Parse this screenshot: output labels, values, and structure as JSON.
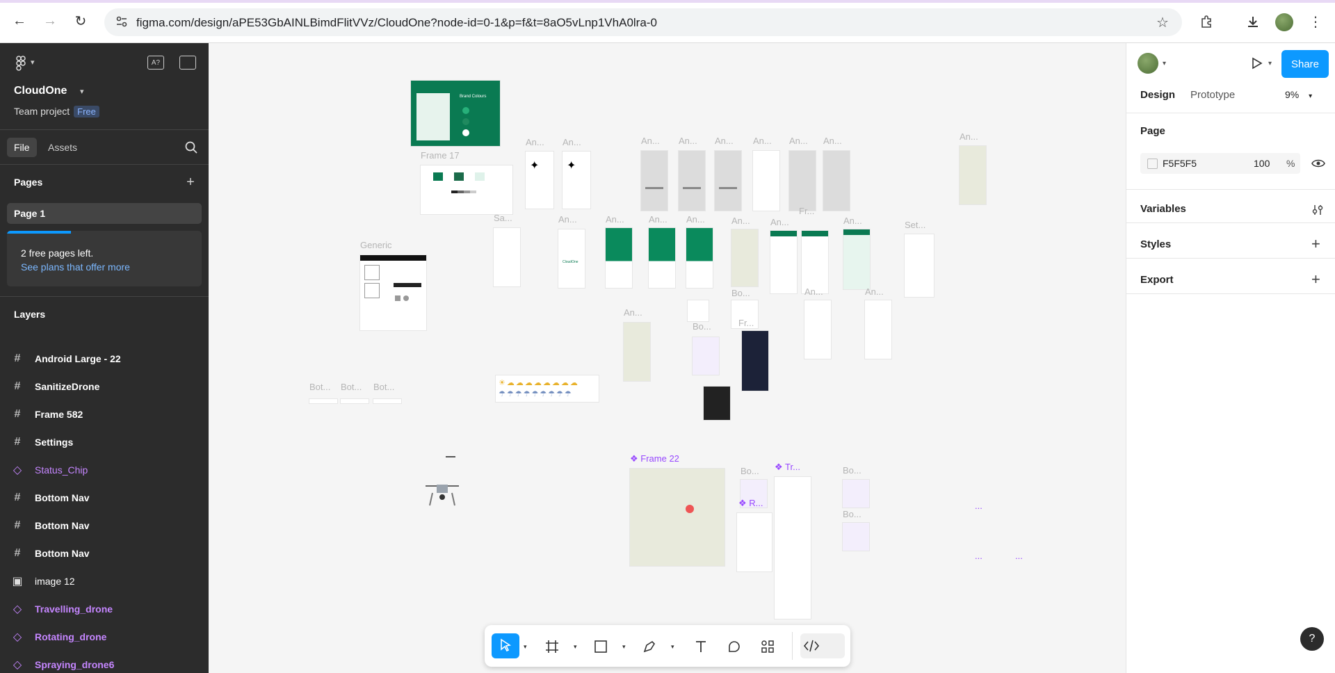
{
  "browser": {
    "url": "figma.com/design/aPE53GbAINLBimdFlitVVz/CloudOne?node-id=0-1&p=f&t=8aO5vLnp1VhA0lra-0"
  },
  "left_panel": {
    "project_name": "CloudOne",
    "team": "Team project",
    "plan_badge": "Free",
    "tabs": [
      "File",
      "Assets"
    ],
    "pages_title": "Pages",
    "pages": [
      "Page 1"
    ],
    "free_pages_text": "2 free pages left.",
    "free_pages_link": "See plans that offer more",
    "free_pages_progress": 0.33,
    "layers_title": "Layers",
    "layers": [
      {
        "label": "Android Large - 22",
        "type": "frame"
      },
      {
        "label": "SanitizeDrone",
        "type": "frame"
      },
      {
        "label": "Frame 582",
        "type": "frame"
      },
      {
        "label": "Settings",
        "type": "frame"
      },
      {
        "label": "Status_Chip",
        "type": "component"
      },
      {
        "label": "Bottom Nav",
        "type": "frame"
      },
      {
        "label": "Bottom Nav",
        "type": "frame"
      },
      {
        "label": "Bottom Nav",
        "type": "frame"
      },
      {
        "label": "image 12",
        "type": "image"
      },
      {
        "label": "Travelling_drone",
        "type": "component"
      },
      {
        "label": "Rotating_drone",
        "type": "component"
      },
      {
        "label": "Spraying_drone6",
        "type": "component"
      }
    ]
  },
  "right_panel": {
    "tabs": [
      "Design",
      "Prototype"
    ],
    "zoom": "9%",
    "share_label": "Share",
    "page_section": "Page",
    "page_color": "F5F5F5",
    "page_opacity": "100",
    "page_opacity_unit": "%",
    "sections": [
      "Variables",
      "Styles",
      "Export"
    ],
    "help": "?"
  },
  "canvas": {
    "labels": {
      "frame17": "Frame 17",
      "generic": "Generic",
      "frame22": "Frame 22",
      "an": "An...",
      "sa": "Sa...",
      "set": "Set...",
      "fr": "Fr...",
      "bo": "Bo...",
      "bot": "Bot...",
      "tr": "Tr...",
      "r": "R...",
      "dots": "...",
      "brand_colours": "Brand Colours",
      "cloudone_small": "CloudOne"
    }
  },
  "colors": {
    "accent": "#0d99ff",
    "brand_green": "#0a7a52",
    "component_purple": "#9747ff",
    "panel_dark": "#2c2c2c"
  }
}
